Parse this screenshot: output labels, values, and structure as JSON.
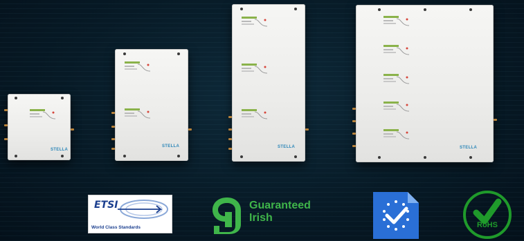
{
  "products": [
    {
      "name": "repeater-small",
      "modules": 1
    },
    {
      "name": "repeater-medium",
      "modules": 2
    },
    {
      "name": "repeater-large",
      "modules": 3
    },
    {
      "name": "repeater-xlarge",
      "modules": 5
    }
  ],
  "brand_logo": "STELLA",
  "badges": {
    "etsi": {
      "word": "ETSI",
      "subtitle": "World Class Standards"
    },
    "guaranteed_irish": {
      "line1": "Guaranteed",
      "line2": "Irish"
    },
    "rohs": {
      "label": "RoHS"
    }
  },
  "colors": {
    "background": "#071a26",
    "gi_green": "#3fb54a",
    "etsi_blue": "#1b3f8f",
    "eu_blue": "#2a6fd6",
    "rohs_green": "#1f9a2b"
  }
}
